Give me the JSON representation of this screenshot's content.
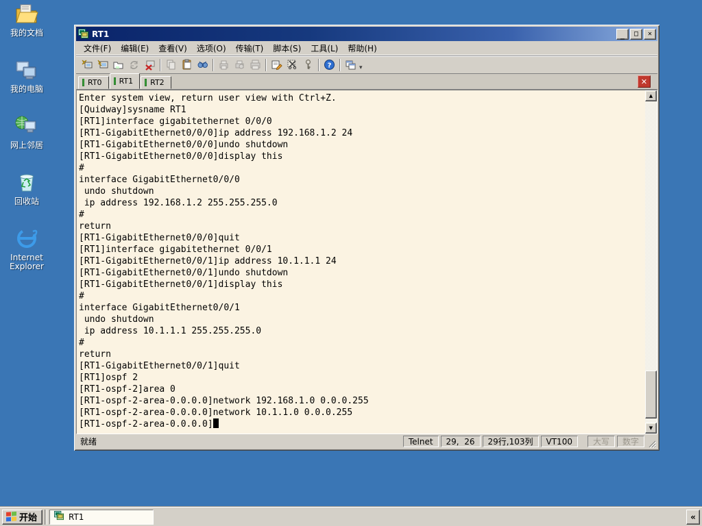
{
  "colors": {
    "desktop": "#3a76b5",
    "chrome": "#d4d0c8",
    "titlebar_left": "#0a246a",
    "titlebar_right": "#8fb0e0",
    "terminal_bg": "#fbf3e2",
    "tab_indicator": "#3ba53b",
    "tab_close_bg": "#c0392e"
  },
  "icons": {
    "minimize": "_",
    "maximize": "□",
    "close": "✕",
    "tab_close": "✕",
    "scroll_up": "▲",
    "scroll_down": "▼",
    "collapse": "«",
    "dropdown": "▾"
  },
  "desktop": {
    "items": [
      {
        "name": "my-documents",
        "label": "我的文档"
      },
      {
        "name": "my-computer",
        "label": "我的电脑"
      },
      {
        "name": "network-places",
        "label": "网上邻居"
      },
      {
        "name": "recycle-bin",
        "label": "回收站"
      },
      {
        "name": "internet-explorer",
        "label": "Internet Explorer"
      }
    ]
  },
  "window": {
    "title": "RT1",
    "menu": [
      "文件(F)",
      "编辑(E)",
      "查看(V)",
      "选项(O)",
      "传输(T)",
      "脚本(S)",
      "工具(L)",
      "帮助(H)"
    ],
    "toolbar": [
      {
        "name": "quick-connect-icon",
        "enabled": true
      },
      {
        "name": "connect-icon",
        "enabled": true
      },
      {
        "name": "connect-tab-icon",
        "enabled": true
      },
      {
        "name": "reconnect-icon",
        "enabled": false
      },
      {
        "name": "disconnect-icon",
        "enabled": true
      },
      {
        "sep": true
      },
      {
        "name": "copy-icon",
        "enabled": false
      },
      {
        "name": "paste-icon",
        "enabled": true
      },
      {
        "name": "find-icon",
        "enabled": true
      },
      {
        "sep": true
      },
      {
        "name": "print-icon",
        "enabled": false
      },
      {
        "name": "print-preview-icon",
        "enabled": false
      },
      {
        "name": "printer-icon",
        "enabled": false
      },
      {
        "sep": true
      },
      {
        "name": "properties-icon",
        "enabled": true
      },
      {
        "name": "session-options-icon",
        "enabled": true
      },
      {
        "name": "key-icon",
        "enabled": true
      },
      {
        "sep": true
      },
      {
        "name": "help-icon",
        "enabled": true
      },
      {
        "sep": true
      },
      {
        "name": "cascade-windows-icon",
        "enabled": true
      }
    ],
    "tabs": [
      {
        "label": "RT0",
        "active": false
      },
      {
        "label": "RT1",
        "active": true
      },
      {
        "label": "RT2",
        "active": false
      }
    ],
    "terminal": {
      "cursor_visible": true,
      "lines": [
        "Enter system view, return user view with Ctrl+Z.",
        "[Quidway]sysname RT1",
        "[RT1]interface gigabitethernet 0/0/0",
        "[RT1-GigabitEthernet0/0/0]ip address 192.168.1.2 24",
        "[RT1-GigabitEthernet0/0/0]undo shutdown",
        "[RT1-GigabitEthernet0/0/0]display this",
        "#",
        "interface GigabitEthernet0/0/0",
        " undo shutdown",
        " ip address 192.168.1.2 255.255.255.0",
        "#",
        "return",
        "[RT1-GigabitEthernet0/0/0]quit",
        "[RT1]interface gigabitethernet 0/0/1",
        "[RT1-GigabitEthernet0/0/1]ip address 10.1.1.1 24",
        "[RT1-GigabitEthernet0/0/1]undo shutdown",
        "[RT1-GigabitEthernet0/0/1]display this",
        "#",
        "interface GigabitEthernet0/0/1",
        " undo shutdown",
        " ip address 10.1.1.1 255.255.255.0",
        "#",
        "return",
        "[RT1-GigabitEthernet0/0/1]quit",
        "[RT1]ospf 2",
        "[RT1-ospf-2]area 0",
        "[RT1-ospf-2-area-0.0.0.0]network 192.168.1.0 0.0.0.255",
        "[RT1-ospf-2-area-0.0.0.0]network 10.1.1.0 0.0.0.255",
        "[RT1-ospf-2-area-0.0.0.0]"
      ]
    },
    "statusbar": {
      "ready": "就绪",
      "protocol": "Telnet",
      "cursor_pos": "29,  26",
      "size": "29行,103列",
      "emulation": "VT100",
      "caps": "大写",
      "num": "数字"
    }
  },
  "taskbar": {
    "start_label": "开始",
    "tasks": [
      {
        "label": "RT1",
        "active": true
      }
    ]
  }
}
